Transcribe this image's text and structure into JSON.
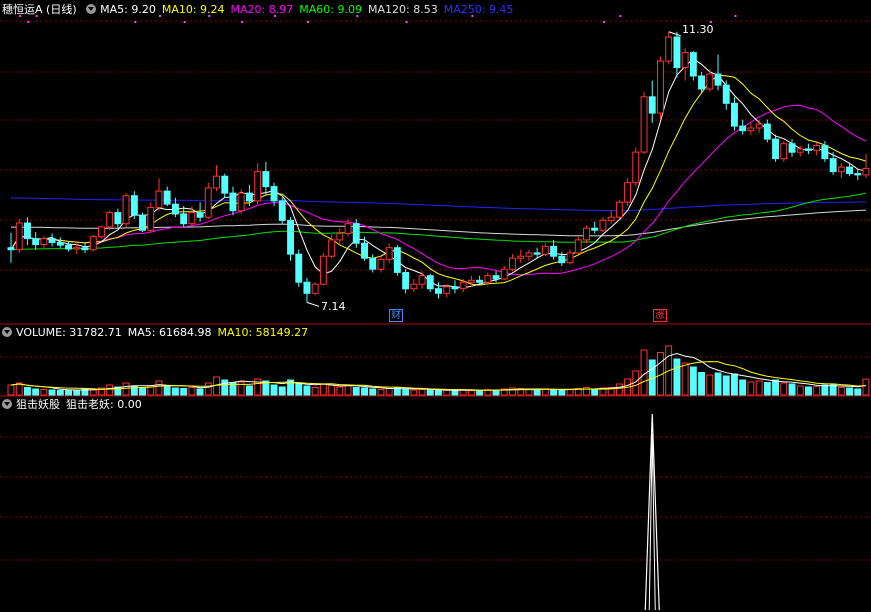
{
  "price_panel": {
    "title": "穗恒运A (日线)",
    "ma_legend": [
      {
        "label": "MA5: 9.20",
        "color": "#ffffff"
      },
      {
        "label": "MA10: 9.24",
        "color": "#ffff00"
      },
      {
        "label": "MA20: 8.97",
        "color": "#ff00ff"
      },
      {
        "label": "MA60: 9.09",
        "color": "#00ff00"
      },
      {
        "label": "MA120: 8.53",
        "color": "#e0e0e0"
      },
      {
        "label": "MA250: 9.45",
        "color": "#3030ff"
      }
    ],
    "high_label": "11.30",
    "low_label": "7.14",
    "event_marks": [
      {
        "text": "财",
        "color": "#3a8cff"
      },
      {
        "text": "涨",
        "color": "#ff3030"
      }
    ]
  },
  "volume_panel": {
    "legend": [
      {
        "label": "VOLUME: 31782.71",
        "color": "#ffffff"
      },
      {
        "label": "MA5: 61684.98",
        "color": "#ffffff"
      },
      {
        "label": "MA10: 58149.27",
        "color": "#ffff00"
      }
    ]
  },
  "indicator_panel": {
    "legend": [
      {
        "label": "狙击妖股",
        "color": "#ffffff"
      },
      {
        "label": "狙击老妖: 0.00",
        "color": "#ffffff"
      }
    ]
  },
  "colors": {
    "up": "#ff3232",
    "down": "#54ffff",
    "grid": "#8b0000",
    "blue_line": "#2222ff"
  },
  "chart_data": {
    "type": "candlestick",
    "price_range": [
      6.9,
      11.45
    ],
    "candles": [
      [
        7.98,
        8.21,
        7.75,
        7.95
      ],
      [
        7.95,
        8.42,
        7.9,
        8.36
      ],
      [
        8.36,
        8.45,
        8.02,
        8.12
      ],
      [
        8.12,
        8.22,
        7.95,
        8.03
      ],
      [
        8.03,
        8.16,
        7.98,
        8.12
      ],
      [
        8.12,
        8.2,
        8.0,
        8.06
      ],
      [
        8.06,
        8.14,
        7.98,
        8.02
      ],
      [
        8.02,
        8.08,
        7.92,
        7.96
      ],
      [
        7.96,
        8.05,
        7.88,
        7.98
      ],
      [
        7.98,
        8.05,
        7.9,
        7.95
      ],
      [
        7.95,
        8.18,
        7.92,
        8.15
      ],
      [
        8.15,
        8.32,
        8.12,
        8.3
      ],
      [
        8.3,
        8.55,
        8.25,
        8.52
      ],
      [
        8.52,
        8.58,
        8.28,
        8.35
      ],
      [
        8.35,
        8.82,
        8.3,
        8.78
      ],
      [
        8.78,
        8.85,
        8.42,
        8.48
      ],
      [
        8.48,
        8.52,
        8.22,
        8.25
      ],
      [
        8.25,
        8.68,
        8.22,
        8.6
      ],
      [
        8.6,
        9.05,
        8.55,
        8.85
      ],
      [
        8.85,
        8.92,
        8.62,
        8.65
      ],
      [
        8.65,
        8.75,
        8.45,
        8.5
      ],
      [
        8.5,
        8.62,
        8.3,
        8.35
      ],
      [
        8.35,
        8.62,
        8.3,
        8.52
      ],
      [
        8.52,
        8.68,
        8.38,
        8.45
      ],
      [
        8.45,
        8.98,
        8.42,
        8.9
      ],
      [
        8.9,
        9.25,
        8.85,
        9.08
      ],
      [
        9.08,
        9.12,
        8.75,
        8.82
      ],
      [
        8.82,
        8.92,
        8.48,
        8.55
      ],
      [
        8.55,
        8.88,
        8.5,
        8.82
      ],
      [
        8.82,
        8.95,
        8.62,
        8.7
      ],
      [
        8.7,
        9.28,
        8.65,
        9.15
      ],
      [
        9.15,
        9.3,
        8.8,
        8.92
      ],
      [
        8.92,
        8.98,
        8.62,
        8.7
      ],
      [
        8.7,
        8.75,
        8.35,
        8.4
      ],
      [
        8.4,
        8.45,
        7.78,
        7.88
      ],
      [
        7.88,
        7.95,
        7.38,
        7.45
      ],
      [
        7.45,
        7.52,
        7.14,
        7.28
      ],
      [
        7.28,
        7.45,
        7.25,
        7.42
      ],
      [
        7.42,
        7.9,
        7.4,
        7.85
      ],
      [
        7.85,
        8.18,
        7.82,
        8.1
      ],
      [
        8.1,
        8.28,
        8.02,
        8.2
      ],
      [
        8.2,
        8.42,
        8.15,
        8.35
      ],
      [
        8.35,
        8.42,
        7.98,
        8.05
      ],
      [
        8.05,
        8.15,
        7.78,
        7.82
      ],
      [
        7.82,
        7.88,
        7.6,
        7.65
      ],
      [
        7.65,
        7.85,
        7.6,
        7.8
      ],
      [
        7.8,
        8.05,
        7.75,
        7.98
      ],
      [
        7.98,
        8.02,
        7.55,
        7.6
      ],
      [
        7.6,
        7.65,
        7.28,
        7.35
      ],
      [
        7.35,
        7.5,
        7.3,
        7.42
      ],
      [
        7.42,
        7.62,
        7.35,
        7.55
      ],
      [
        7.55,
        7.58,
        7.3,
        7.35
      ],
      [
        7.35,
        7.45,
        7.2,
        7.28
      ],
      [
        7.28,
        7.42,
        7.22,
        7.38
      ],
      [
        7.38,
        7.48,
        7.28,
        7.35
      ],
      [
        7.35,
        7.5,
        7.3,
        7.45
      ],
      [
        7.45,
        7.55,
        7.38,
        7.48
      ],
      [
        7.48,
        7.55,
        7.4,
        7.45
      ],
      [
        7.45,
        7.6,
        7.42,
        7.55
      ],
      [
        7.55,
        7.62,
        7.45,
        7.5
      ],
      [
        7.5,
        7.7,
        7.48,
        7.65
      ],
      [
        7.65,
        7.88,
        7.62,
        7.82
      ],
      [
        7.82,
        7.95,
        7.75,
        7.85
      ],
      [
        7.85,
        7.95,
        7.78,
        7.9
      ],
      [
        7.9,
        7.98,
        7.82,
        7.88
      ],
      [
        7.88,
        8.05,
        7.85,
        8.0
      ],
      [
        8.0,
        8.1,
        7.8,
        7.85
      ],
      [
        7.85,
        7.92,
        7.7,
        7.75
      ],
      [
        7.75,
        7.95,
        7.72,
        7.9
      ],
      [
        7.9,
        8.15,
        7.88,
        8.1
      ],
      [
        8.1,
        8.32,
        8.05,
        8.28
      ],
      [
        8.28,
        8.38,
        8.2,
        8.25
      ],
      [
        8.25,
        8.45,
        8.22,
        8.4
      ],
      [
        8.4,
        8.55,
        8.35,
        8.45
      ],
      [
        8.45,
        8.72,
        8.42,
        8.68
      ],
      [
        8.68,
        9.05,
        8.62,
        8.98
      ],
      [
        8.98,
        9.52,
        8.92,
        9.45
      ],
      [
        9.45,
        10.38,
        9.42,
        10.3
      ],
      [
        10.3,
        10.55,
        9.9,
        10.05
      ],
      [
        10.05,
        10.92,
        9.95,
        10.85
      ],
      [
        10.85,
        11.3,
        10.8,
        11.22
      ],
      [
        11.22,
        11.3,
        10.6,
        10.75
      ],
      [
        10.75,
        11.05,
        10.55,
        10.98
      ],
      [
        10.98,
        11.0,
        10.55,
        10.62
      ],
      [
        10.62,
        10.68,
        10.35,
        10.42
      ],
      [
        10.42,
        10.72,
        10.38,
        10.65
      ],
      [
        10.65,
        10.95,
        10.4,
        10.48
      ],
      [
        10.48,
        10.55,
        10.1,
        10.2
      ],
      [
        10.2,
        10.3,
        9.78,
        9.85
      ],
      [
        9.85,
        9.95,
        9.72,
        9.78
      ],
      [
        9.78,
        9.9,
        9.72,
        9.82
      ],
      [
        9.82,
        9.95,
        9.75,
        9.88
      ],
      [
        9.88,
        9.95,
        9.6,
        9.65
      ],
      [
        9.65,
        9.72,
        9.3,
        9.35
      ],
      [
        9.35,
        9.62,
        9.3,
        9.58
      ],
      [
        9.58,
        9.65,
        9.38,
        9.45
      ],
      [
        9.45,
        9.55,
        9.38,
        9.5
      ],
      [
        9.5,
        9.58,
        9.42,
        9.48
      ],
      [
        9.48,
        9.6,
        9.4,
        9.55
      ],
      [
        9.55,
        9.62,
        9.3,
        9.35
      ],
      [
        9.35,
        9.45,
        9.1,
        9.15
      ],
      [
        9.15,
        9.28,
        9.05,
        9.22
      ],
      [
        9.22,
        9.28,
        9.08,
        9.12
      ],
      [
        9.12,
        9.2,
        9.02,
        9.1
      ],
      [
        9.1,
        9.42,
        9.05,
        9.2
      ]
    ],
    "volume": [
      [
        20000,
        1
      ],
      [
        24000,
        1
      ],
      [
        15000,
        0
      ],
      [
        12000,
        0
      ],
      [
        11000,
        1
      ],
      [
        10000,
        0
      ],
      [
        9000,
        0
      ],
      [
        10000,
        0
      ],
      [
        9500,
        0
      ],
      [
        12000,
        0
      ],
      [
        11000,
        1
      ],
      [
        14000,
        1
      ],
      [
        20000,
        1
      ],
      [
        16000,
        0
      ],
      [
        24000,
        1
      ],
      [
        18000,
        0
      ],
      [
        15000,
        0
      ],
      [
        19000,
        1
      ],
      [
        28000,
        1
      ],
      [
        18000,
        0
      ],
      [
        14000,
        0
      ],
      [
        13000,
        0
      ],
      [
        15000,
        1
      ],
      [
        12000,
        0
      ],
      [
        24000,
        1
      ],
      [
        36000,
        1
      ],
      [
        30000,
        0
      ],
      [
        24000,
        0
      ],
      [
        26000,
        1
      ],
      [
        18000,
        0
      ],
      [
        32000,
        1
      ],
      [
        28000,
        0
      ],
      [
        20000,
        0
      ],
      [
        16000,
        0
      ],
      [
        30000,
        0
      ],
      [
        24000,
        0
      ],
      [
        18000,
        0
      ],
      [
        15000,
        1
      ],
      [
        22000,
        1
      ],
      [
        20000,
        1
      ],
      [
        16000,
        1
      ],
      [
        20000,
        1
      ],
      [
        15000,
        0
      ],
      [
        14000,
        0
      ],
      [
        12000,
        0
      ],
      [
        11000,
        1
      ],
      [
        13000,
        1
      ],
      [
        15000,
        0
      ],
      [
        12000,
        0
      ],
      [
        10000,
        1
      ],
      [
        11000,
        1
      ],
      [
        10000,
        0
      ],
      [
        9000,
        0
      ],
      [
        9500,
        1
      ],
      [
        9000,
        0
      ],
      [
        10000,
        1
      ],
      [
        9500,
        1
      ],
      [
        9000,
        0
      ],
      [
        10500,
        1
      ],
      [
        10000,
        0
      ],
      [
        12000,
        1
      ],
      [
        14000,
        1
      ],
      [
        13000,
        1
      ],
      [
        11000,
        1
      ],
      [
        10000,
        0
      ],
      [
        12000,
        1
      ],
      [
        11000,
        0
      ],
      [
        10000,
        0
      ],
      [
        11000,
        1
      ],
      [
        13000,
        1
      ],
      [
        15000,
        1
      ],
      [
        12000,
        0
      ],
      [
        14000,
        1
      ],
      [
        15000,
        1
      ],
      [
        22000,
        1
      ],
      [
        32000,
        1
      ],
      [
        48000,
        1
      ],
      [
        90000,
        1
      ],
      [
        70000,
        0
      ],
      [
        85000,
        1
      ],
      [
        98000,
        1
      ],
      [
        72000,
        0
      ],
      [
        64000,
        1
      ],
      [
        56000,
        0
      ],
      [
        45000,
        0
      ],
      [
        40000,
        1
      ],
      [
        44000,
        0
      ],
      [
        38000,
        0
      ],
      [
        42000,
        0
      ],
      [
        30000,
        0
      ],
      [
        26000,
        1
      ],
      [
        28000,
        1
      ],
      [
        25000,
        0
      ],
      [
        30000,
        0
      ],
      [
        24000,
        1
      ],
      [
        22000,
        0
      ],
      [
        18000,
        1
      ],
      [
        16000,
        0
      ],
      [
        17000,
        1
      ],
      [
        20000,
        0
      ],
      [
        22000,
        0
      ],
      [
        15000,
        1
      ],
      [
        14000,
        0
      ],
      [
        12000,
        0
      ],
      [
        31783,
        1
      ]
    ],
    "volume_range": [
      0,
      110000
    ],
    "indicator": {
      "name": "狙击老妖",
      "spike_index": 78,
      "spike_level": 1.0,
      "value": 0.0
    }
  }
}
